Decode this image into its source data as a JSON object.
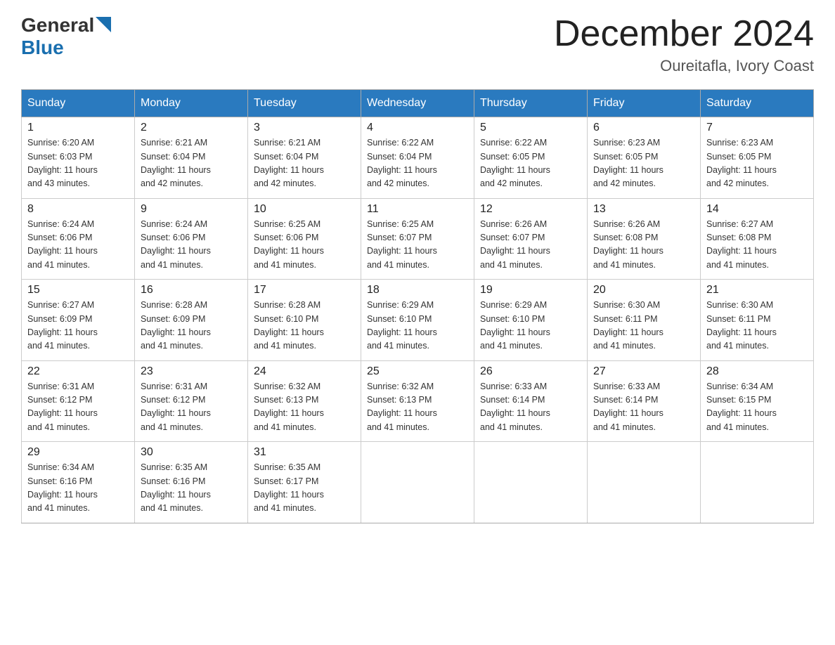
{
  "header": {
    "logo_general": "General",
    "logo_blue": "Blue",
    "month_title": "December 2024",
    "location": "Oureitafla, Ivory Coast"
  },
  "weekdays": [
    "Sunday",
    "Monday",
    "Tuesday",
    "Wednesday",
    "Thursday",
    "Friday",
    "Saturday"
  ],
  "weeks": [
    [
      {
        "day": "1",
        "sunrise": "6:20 AM",
        "sunset": "6:03 PM",
        "daylight": "11 hours and 43 minutes."
      },
      {
        "day": "2",
        "sunrise": "6:21 AM",
        "sunset": "6:04 PM",
        "daylight": "11 hours and 42 minutes."
      },
      {
        "day": "3",
        "sunrise": "6:21 AM",
        "sunset": "6:04 PM",
        "daylight": "11 hours and 42 minutes."
      },
      {
        "day": "4",
        "sunrise": "6:22 AM",
        "sunset": "6:04 PM",
        "daylight": "11 hours and 42 minutes."
      },
      {
        "day": "5",
        "sunrise": "6:22 AM",
        "sunset": "6:05 PM",
        "daylight": "11 hours and 42 minutes."
      },
      {
        "day": "6",
        "sunrise": "6:23 AM",
        "sunset": "6:05 PM",
        "daylight": "11 hours and 42 minutes."
      },
      {
        "day": "7",
        "sunrise": "6:23 AM",
        "sunset": "6:05 PM",
        "daylight": "11 hours and 42 minutes."
      }
    ],
    [
      {
        "day": "8",
        "sunrise": "6:24 AM",
        "sunset": "6:06 PM",
        "daylight": "11 hours and 41 minutes."
      },
      {
        "day": "9",
        "sunrise": "6:24 AM",
        "sunset": "6:06 PM",
        "daylight": "11 hours and 41 minutes."
      },
      {
        "day": "10",
        "sunrise": "6:25 AM",
        "sunset": "6:06 PM",
        "daylight": "11 hours and 41 minutes."
      },
      {
        "day": "11",
        "sunrise": "6:25 AM",
        "sunset": "6:07 PM",
        "daylight": "11 hours and 41 minutes."
      },
      {
        "day": "12",
        "sunrise": "6:26 AM",
        "sunset": "6:07 PM",
        "daylight": "11 hours and 41 minutes."
      },
      {
        "day": "13",
        "sunrise": "6:26 AM",
        "sunset": "6:08 PM",
        "daylight": "11 hours and 41 minutes."
      },
      {
        "day": "14",
        "sunrise": "6:27 AM",
        "sunset": "6:08 PM",
        "daylight": "11 hours and 41 minutes."
      }
    ],
    [
      {
        "day": "15",
        "sunrise": "6:27 AM",
        "sunset": "6:09 PM",
        "daylight": "11 hours and 41 minutes."
      },
      {
        "day": "16",
        "sunrise": "6:28 AM",
        "sunset": "6:09 PM",
        "daylight": "11 hours and 41 minutes."
      },
      {
        "day": "17",
        "sunrise": "6:28 AM",
        "sunset": "6:10 PM",
        "daylight": "11 hours and 41 minutes."
      },
      {
        "day": "18",
        "sunrise": "6:29 AM",
        "sunset": "6:10 PM",
        "daylight": "11 hours and 41 minutes."
      },
      {
        "day": "19",
        "sunrise": "6:29 AM",
        "sunset": "6:10 PM",
        "daylight": "11 hours and 41 minutes."
      },
      {
        "day": "20",
        "sunrise": "6:30 AM",
        "sunset": "6:11 PM",
        "daylight": "11 hours and 41 minutes."
      },
      {
        "day": "21",
        "sunrise": "6:30 AM",
        "sunset": "6:11 PM",
        "daylight": "11 hours and 41 minutes."
      }
    ],
    [
      {
        "day": "22",
        "sunrise": "6:31 AM",
        "sunset": "6:12 PM",
        "daylight": "11 hours and 41 minutes."
      },
      {
        "day": "23",
        "sunrise": "6:31 AM",
        "sunset": "6:12 PM",
        "daylight": "11 hours and 41 minutes."
      },
      {
        "day": "24",
        "sunrise": "6:32 AM",
        "sunset": "6:13 PM",
        "daylight": "11 hours and 41 minutes."
      },
      {
        "day": "25",
        "sunrise": "6:32 AM",
        "sunset": "6:13 PM",
        "daylight": "11 hours and 41 minutes."
      },
      {
        "day": "26",
        "sunrise": "6:33 AM",
        "sunset": "6:14 PM",
        "daylight": "11 hours and 41 minutes."
      },
      {
        "day": "27",
        "sunrise": "6:33 AM",
        "sunset": "6:14 PM",
        "daylight": "11 hours and 41 minutes."
      },
      {
        "day": "28",
        "sunrise": "6:34 AM",
        "sunset": "6:15 PM",
        "daylight": "11 hours and 41 minutes."
      }
    ],
    [
      {
        "day": "29",
        "sunrise": "6:34 AM",
        "sunset": "6:16 PM",
        "daylight": "11 hours and 41 minutes."
      },
      {
        "day": "30",
        "sunrise": "6:35 AM",
        "sunset": "6:16 PM",
        "daylight": "11 hours and 41 minutes."
      },
      {
        "day": "31",
        "sunrise": "6:35 AM",
        "sunset": "6:17 PM",
        "daylight": "11 hours and 41 minutes."
      },
      null,
      null,
      null,
      null
    ]
  ],
  "labels": {
    "sunrise": "Sunrise:",
    "sunset": "Sunset:",
    "daylight": "Daylight:"
  }
}
